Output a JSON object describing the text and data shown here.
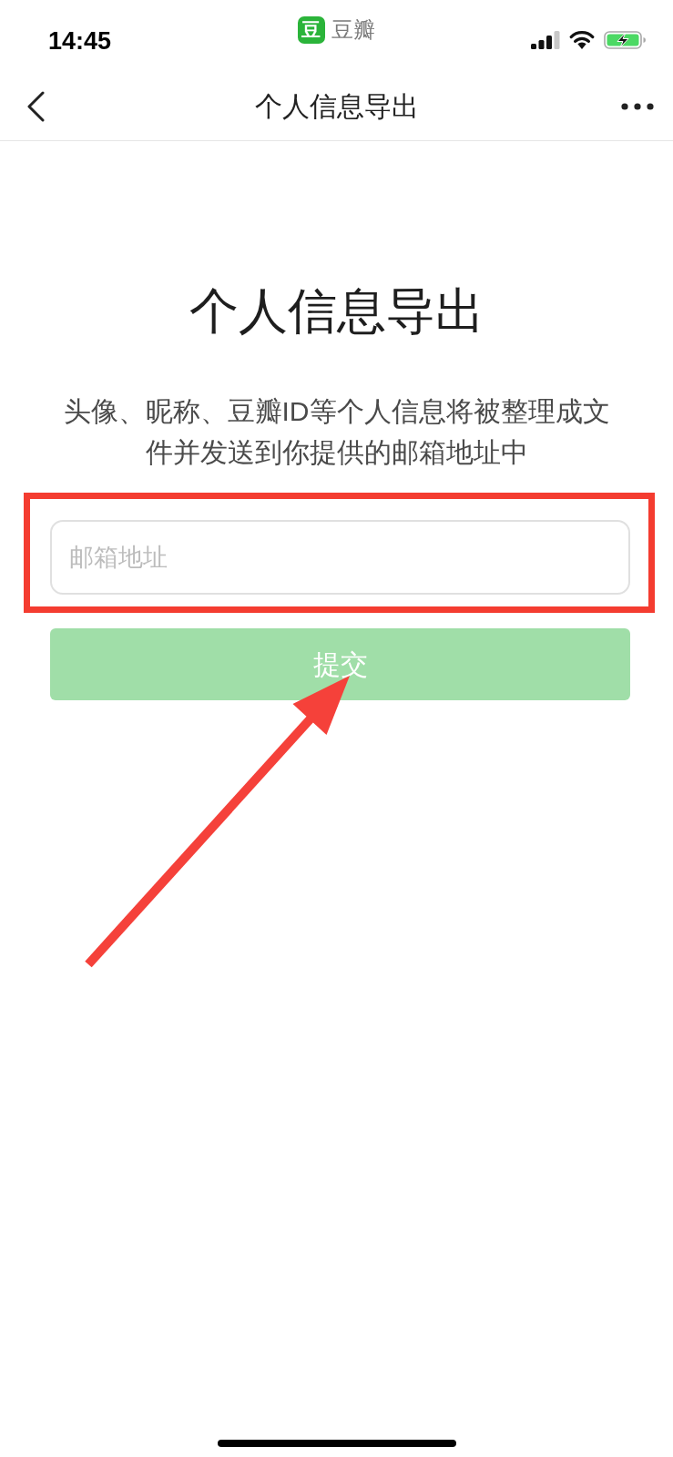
{
  "status_bar": {
    "time": "14:45",
    "app_logo": "豆",
    "app_name": "豆瓣"
  },
  "nav_bar": {
    "title": "个人信息导出"
  },
  "page": {
    "heading": "个人信息导出",
    "description": "头像、昵称、豆瓣ID等个人信息将被整理成文件并发送到你提供的邮箱地址中",
    "email_field": {
      "placeholder": "邮箱地址"
    },
    "submit_button": {
      "label": "提交",
      "disabled": true
    }
  }
}
